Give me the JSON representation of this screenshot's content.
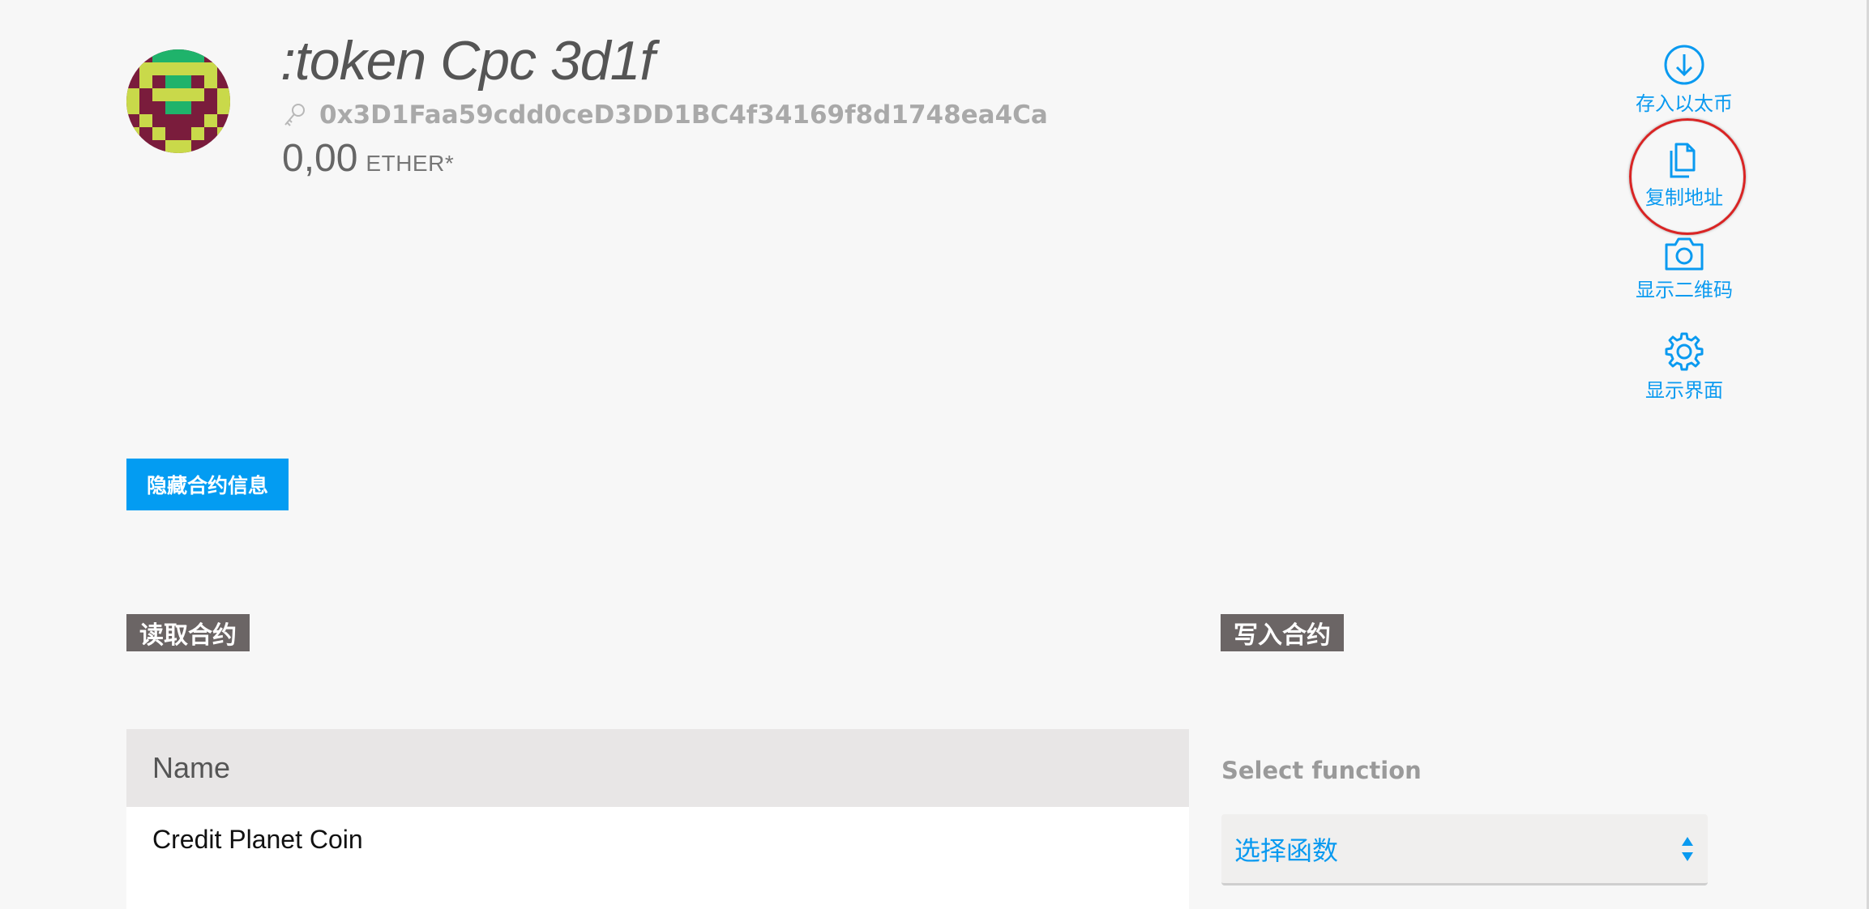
{
  "header": {
    "title": ":token Cpc 3d1f",
    "address": "0x3D1Faa59cdd0ceD3DD1BC4f34169f8d1748ea4Ca",
    "balance": "0,00",
    "currency": "ETHER*"
  },
  "actions": {
    "deposit_label": "存入以太币",
    "copy_label": "复制地址",
    "qr_label": "显示二维码",
    "interface_label": "显示界面"
  },
  "toggle_button": "隐藏合约信息",
  "read_section": {
    "label": "读取合约",
    "name_header": "Name",
    "name_value": "Credit Planet Coin"
  },
  "write_section": {
    "label": "写入合约",
    "select_label": "Select function",
    "select_value": "选择函数"
  },
  "colors": {
    "accent": "#039cf2",
    "section_label_bg": "#6b6565",
    "highlight": "#d92424",
    "page_bg": "#f7f7f7"
  },
  "icons": [
    "identicon-avatar",
    "key-icon",
    "download-circle-icon",
    "copy-file-icon",
    "camera-icon",
    "gear-icon",
    "select-arrows-icon"
  ]
}
